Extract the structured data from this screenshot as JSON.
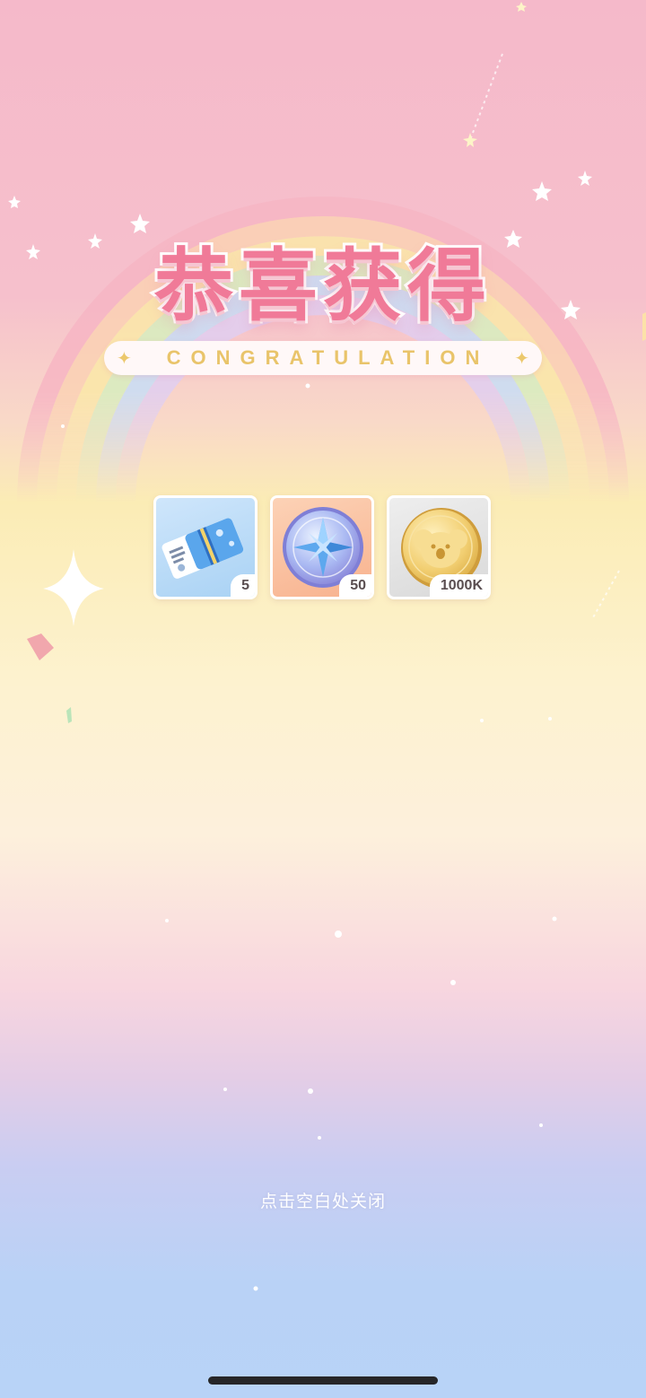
{
  "banner": {
    "title": "恭喜获得",
    "subtitle": "CONGRATULATION"
  },
  "rewards": [
    {
      "name": "ticket",
      "quantity": "5"
    },
    {
      "name": "compass-coin",
      "quantity": "50"
    },
    {
      "name": "gold-coin",
      "quantity": "1000K"
    }
  ],
  "footer": {
    "close_hint": "点击空白处关闭"
  },
  "colors": {
    "title": "#f07a98",
    "subtitle": "#e9c46a",
    "background_top": "#f5b9ca",
    "background_mid": "#fbecb5",
    "background_bottom": "#b8d3f7"
  }
}
